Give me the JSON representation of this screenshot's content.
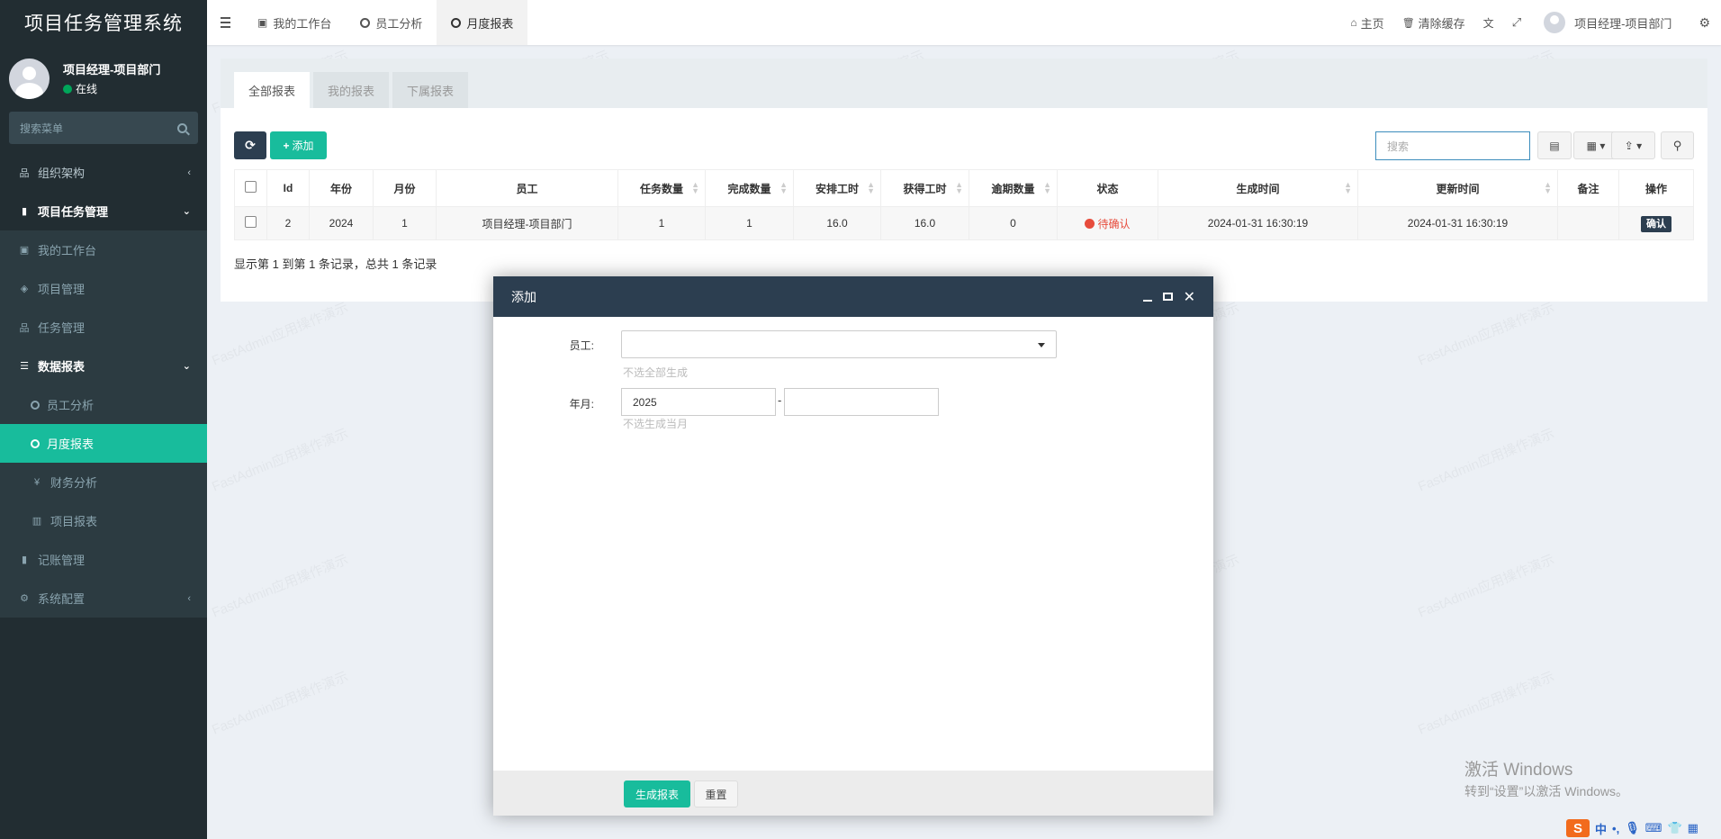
{
  "app": {
    "title": "项目任务管理系统",
    "user_name": "项目经理-项目部门",
    "user_status": "在线",
    "search_placeholder": "搜索菜单"
  },
  "sidebar": {
    "items": [
      {
        "label": "组织架构",
        "icon": "sitemap-icon",
        "arrow": "‹"
      },
      {
        "label": "项目任务管理",
        "icon": "book-icon",
        "arrow": "⌄"
      },
      {
        "label": "我的工作台",
        "icon": "calendar-check-icon"
      },
      {
        "label": "项目管理",
        "icon": "cube-icon"
      },
      {
        "label": "任务管理",
        "icon": "sitemap-icon"
      },
      {
        "label": "数据报表",
        "icon": "list-icon",
        "arrow": "⌄"
      },
      {
        "label": "员工分析",
        "icon": "circle-icon"
      },
      {
        "label": "月度报表",
        "icon": "circle-icon"
      },
      {
        "label": "财务分析",
        "icon": "yen-icon"
      },
      {
        "label": "项目报表",
        "icon": "bar-chart-icon"
      },
      {
        "label": "记账管理",
        "icon": "book-icon"
      },
      {
        "label": "系统配置",
        "icon": "cogs-icon",
        "arrow": "‹"
      }
    ]
  },
  "topbar": {
    "tabs": [
      {
        "label": "我的工作台",
        "icon": "calendar-check-icon"
      },
      {
        "label": "员工分析",
        "icon": "circle-icon"
      },
      {
        "label": "月度报表",
        "icon": "circle-icon"
      }
    ],
    "home": "主页",
    "clear_cache": "清除缓存",
    "user": "项目经理-项目部门"
  },
  "panel": {
    "tabs": [
      "全部报表",
      "我的报表",
      "下属报表"
    ],
    "add_label": "添加",
    "search_placeholder": "搜索",
    "columns": [
      "Id",
      "年份",
      "月份",
      "员工",
      "任务数量",
      "完成数量",
      "安排工时",
      "获得工时",
      "逾期数量",
      "状态",
      "生成时间",
      "更新时间",
      "备注",
      "操作"
    ],
    "rows": [
      {
        "id": "2",
        "year": "2024",
        "month": "1",
        "employee": "项目经理-项目部门",
        "tasks": "1",
        "done": "1",
        "planned_hours": "16.0",
        "earned_hours": "16.0",
        "overdue": "0",
        "status": "待确认",
        "created": "2024-01-31 16:30:19",
        "updated": "2024-01-31 16:30:19",
        "remark": "",
        "action": "确认"
      }
    ],
    "pager": "显示第 1 到第 1 条记录，总共 1 条记录"
  },
  "modal": {
    "title": "添加",
    "employee_label": "员工:",
    "employee_help": "不选全部生成",
    "ym_label": "年月:",
    "year_value": "2025",
    "dash": "-",
    "month_value": "",
    "ym_help": "不选生成当月",
    "submit": "生成报表",
    "reset": "重置"
  },
  "watermark": "FastAdmin应用操作演示",
  "windows": {
    "line1": "激活 Windows",
    "line2": "转到“设置”以激活 Windows。"
  },
  "ime": {
    "lang": "中"
  },
  "colors": {
    "accent": "#18bc9c",
    "dark": "#2c3e50",
    "sidebar": "#222d32",
    "danger": "#e74c3c"
  }
}
